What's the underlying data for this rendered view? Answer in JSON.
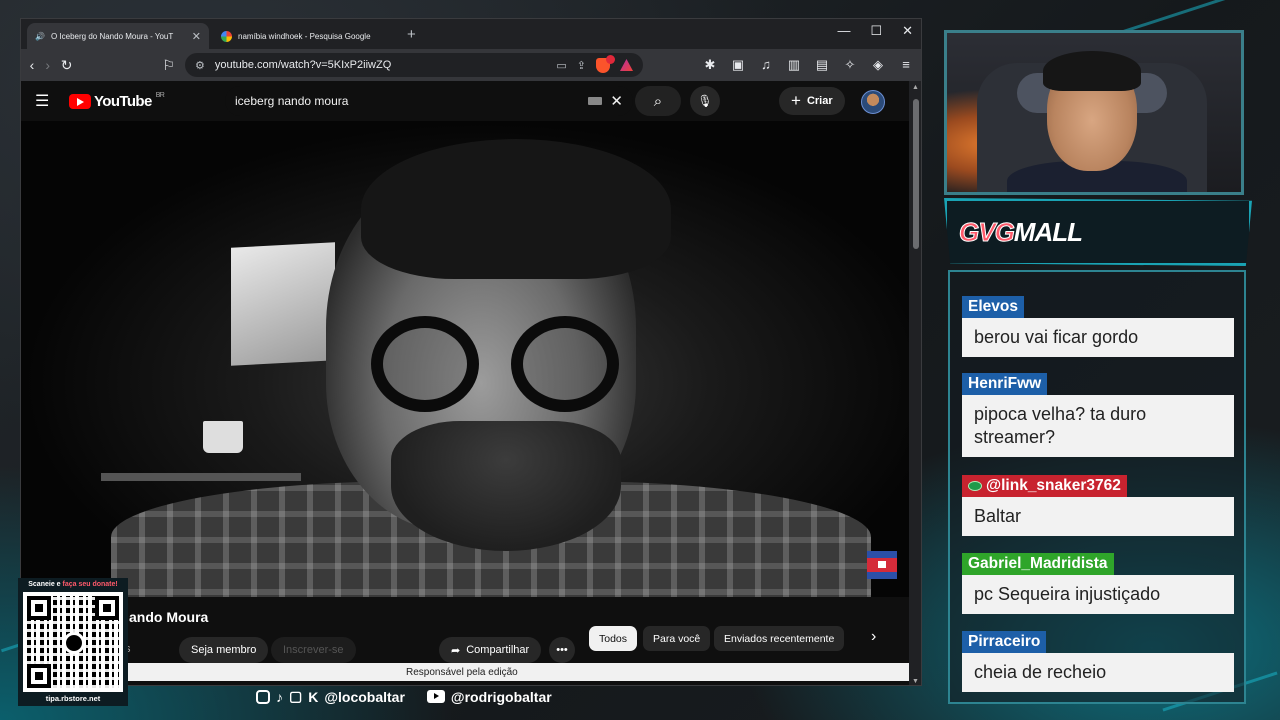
{
  "browser": {
    "tabs": [
      {
        "title": "O Iceberg do Nando Moura - YouT",
        "active": true,
        "favicon": "youtube-icon"
      },
      {
        "title": "namíbia windhoek - Pesquisa Google",
        "active": false,
        "favicon": "google-icon"
      }
    ],
    "url": "youtube.com/watch?v=5KIxP2iiwZQ"
  },
  "youtube": {
    "logo_text": "YouTube",
    "region": "BR",
    "search_query": "iceberg  nando moura",
    "create_label": "Criar",
    "channel_name": "ando Moura",
    "subscribers_fragment": "s",
    "member_label": "Seja membro",
    "subscribe_label": "Inscrever-se",
    "share_label": "Compartilhar",
    "chips": [
      "Todos",
      "Para você",
      "Enviados recentemente"
    ],
    "status_bar": "Responsável pela edição"
  },
  "sponsor": {
    "logo_part1": "GVG",
    "logo_part2": "MALL"
  },
  "chat": [
    {
      "user": "Elevos",
      "color": "#1d5fa8",
      "text": "berou vai ficar gordo"
    },
    {
      "user": "HenriFww",
      "color": "#1d5fa8",
      "text": "pipoca velha? ta duro streamer?"
    },
    {
      "user": "@link_snaker3762",
      "color": "#c8232f",
      "text": "Baltar"
    },
    {
      "user": "Gabriel_Madridista",
      "color": "#2fa52a",
      "text": "pc Sequeira injustiçado"
    },
    {
      "user": "Pirraceiro",
      "color": "#1d5fa8",
      "text": "cheia de recheio"
    }
  ],
  "socials": {
    "handle1": "@locobaltar",
    "handle2": "@rodrigobaltar"
  },
  "qr": {
    "top_text_1": "Scaneie e ",
    "top_text_2": "faça seu donate!",
    "bottom_text": "tipa.rbstore.net"
  }
}
